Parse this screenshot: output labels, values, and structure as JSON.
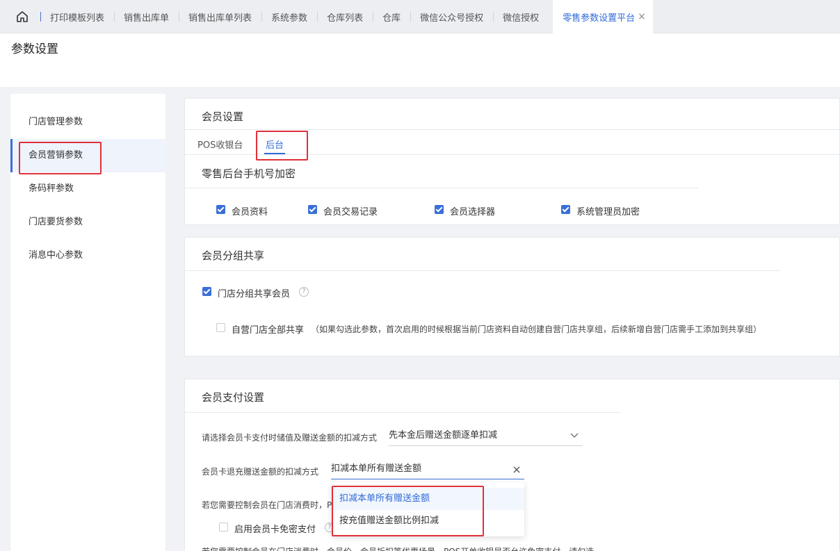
{
  "tabs": [
    {
      "label": "打印模板列表"
    },
    {
      "label": "销售出库单"
    },
    {
      "label": "销售出库单列表"
    },
    {
      "label": "系统参数"
    },
    {
      "label": "仓库列表"
    },
    {
      "label": "仓库"
    },
    {
      "label": "微信公众号授权"
    },
    {
      "label": "微信授权"
    },
    {
      "label": "零售参数设置平台",
      "active": true
    }
  ],
  "tab_close_symbol": "×",
  "page_title": "参数设置",
  "sidebar": {
    "items": [
      {
        "label": "门店管理参数"
      },
      {
        "label": "会员营销参数",
        "active": true
      },
      {
        "label": "条码秤参数"
      },
      {
        "label": "门店要货参数"
      },
      {
        "label": "消息中心参数"
      }
    ]
  },
  "member_settings": {
    "title": "会员设置",
    "subtabs": [
      {
        "label": "POS收银台"
      },
      {
        "label": "后台",
        "active": true
      }
    ],
    "section_title": "零售后台手机号加密",
    "checkboxes": [
      {
        "label": "会员资料",
        "checked": true
      },
      {
        "label": "会员交易记录",
        "checked": true
      },
      {
        "label": "会员选择器",
        "checked": true
      },
      {
        "label": "系统管理员加密",
        "checked": true
      }
    ]
  },
  "group_share": {
    "title": "会员分组共享",
    "store_group_label": "门店分组共享会员",
    "store_group_checked": true,
    "help_symbol": "?",
    "self_store_label": "自营门店全部共享",
    "self_store_checked": false,
    "self_store_note": "（如果勾选此参数，首次启用的时候根据当前门店资料自动创建自营门店共享组，后续新增自营门店需手工添加到共享组）"
  },
  "payment": {
    "title": "会员支付设置",
    "deduct_label": "请选择会员卡支付时储值及赠送金额的扣减方式",
    "deduct_value": "先本金后赠送金额逐单扣减",
    "refund_label": "会员卡退充赠送金额的扣减方式",
    "refund_value": "扣减本单所有赠送金额",
    "refund_options": [
      "扣减本单所有赠送金额",
      "按充值赠送金额比例扣减"
    ],
    "control_text": "若您需要控制会员在门店消费时，P",
    "password_free_label": "启用会员卡免密支付",
    "bottom_text": "若您需要控制会员在门店消费时，会员价、会员折扣等优惠场景，POS开单收银是否允许免密支付，请勾选"
  },
  "icons": {
    "home": "home-icon",
    "chevron": "chevron-down-icon",
    "clear": "close-icon"
  },
  "colors": {
    "accent": "#2f6bd8",
    "highlight_box": "#e0303a"
  }
}
